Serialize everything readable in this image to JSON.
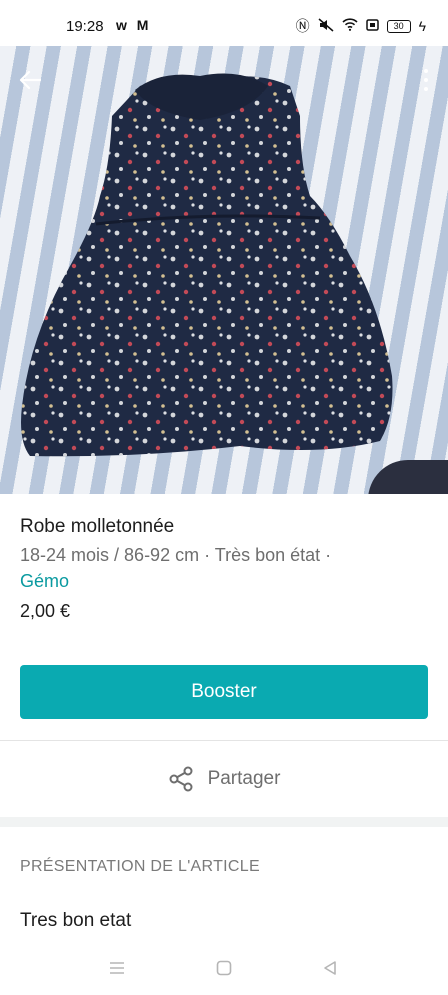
{
  "status_bar": {
    "time": "19:28",
    "app_icons": "w M",
    "battery": "30"
  },
  "product": {
    "title": "Robe molletonnée",
    "meta": "18-24 mois / 86-92 cm · Très bon état ·",
    "brand": "Gémo",
    "price": "2,00 €"
  },
  "actions": {
    "booster_label": "Booster",
    "share_label": "Partager"
  },
  "description_section": {
    "title": "PRÉSENTATION DE L'ARTICLE",
    "text": "Tres bon etat"
  },
  "colors": {
    "accent": "#0aaab1",
    "brand_link": "#0a9aa0",
    "dress": "#1f2a44"
  },
  "icons": {
    "back": "arrow-left-icon",
    "more": "more-vertical-icon",
    "share": "share-icon",
    "nav_menu": "menu-icon",
    "nav_home": "square-icon",
    "nav_back": "triangle-back-icon"
  }
}
